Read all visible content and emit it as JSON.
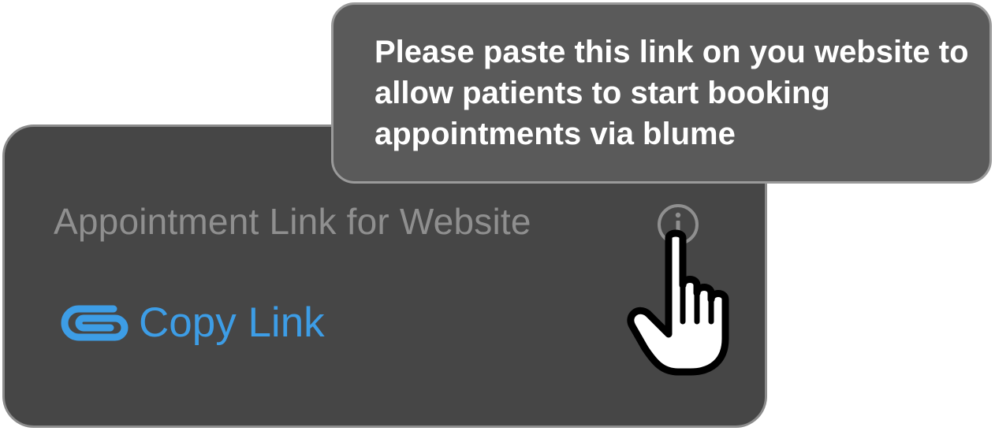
{
  "tooltip": {
    "text": "Please paste this link on you website to allow patients to start booking appointments via blume"
  },
  "card": {
    "title": "Appointment Link for Website",
    "info_icon": "info-circle-icon",
    "copy_link_label": "Copy Link",
    "copy_link_icon": "paperclip-icon"
  },
  "cursor": {
    "icon": "pointing-hand-cursor-icon"
  },
  "colors": {
    "card_bg": "#464646",
    "tooltip_bg": "#5a5a5a",
    "title_text": "#8f8f8f",
    "accent_link": "#3d9de6",
    "tooltip_text": "#ffffff"
  }
}
